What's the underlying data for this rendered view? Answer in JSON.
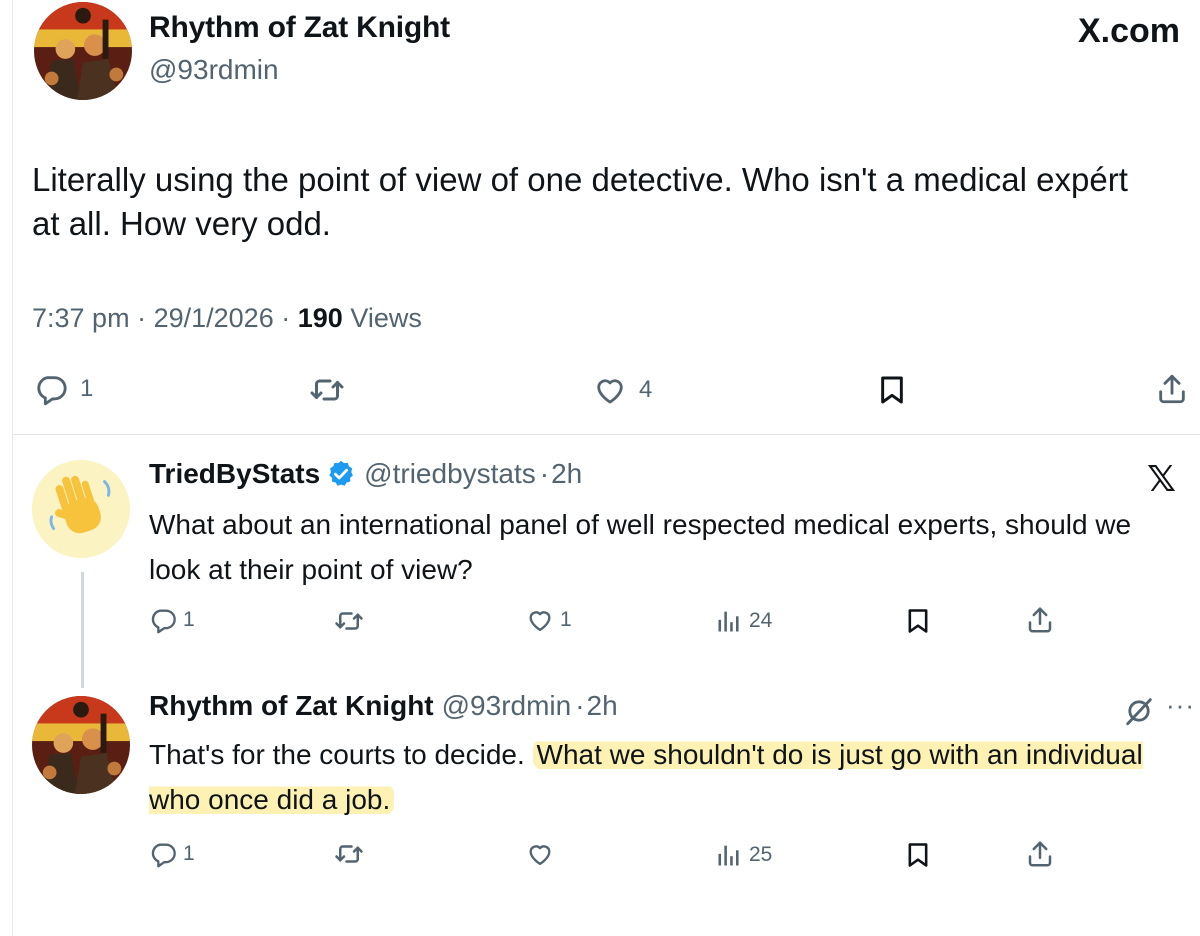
{
  "header": {
    "site": "X.com"
  },
  "main_tweet": {
    "author_name": "Rhythm of Zat Knight",
    "author_handle": "@93rdmin",
    "text": "Literally using the point of view of one detective. Who isn't a medical expért at all. How very odd.",
    "time": "7:37 pm",
    "date": "29/1/2026",
    "views_count": "190",
    "views_label": "Views",
    "separator": "·",
    "replies": "1",
    "likes": "4"
  },
  "reply1": {
    "author_name": "TriedByStats",
    "author_handle": "@triedbystats",
    "age": "2h",
    "text": "What about an international panel of well respected medical experts, should we look at their point of view?",
    "replies": "1",
    "likes": "1",
    "views": "24",
    "close_label": "𝕏"
  },
  "reply2": {
    "author_name": "Rhythm of Zat Knight",
    "author_handle": "@93rdmin",
    "age": "2h",
    "text_plain": "That's for the courts to decide. ",
    "text_highlight": "What we shouldn't do is just go with an individual who once did a job.",
    "replies": "1",
    "views": "25",
    "more_label": "···"
  },
  "colors": {
    "text": "#0f1419",
    "secondary": "#536471",
    "verified": "#1d9bf0",
    "highlight": "#fdf1b4"
  },
  "icons": [
    "reply-icon",
    "retweet-icon",
    "like-icon",
    "bookmark-icon",
    "share-icon",
    "views-icon",
    "verified-badge-icon",
    "mute-icon"
  ]
}
